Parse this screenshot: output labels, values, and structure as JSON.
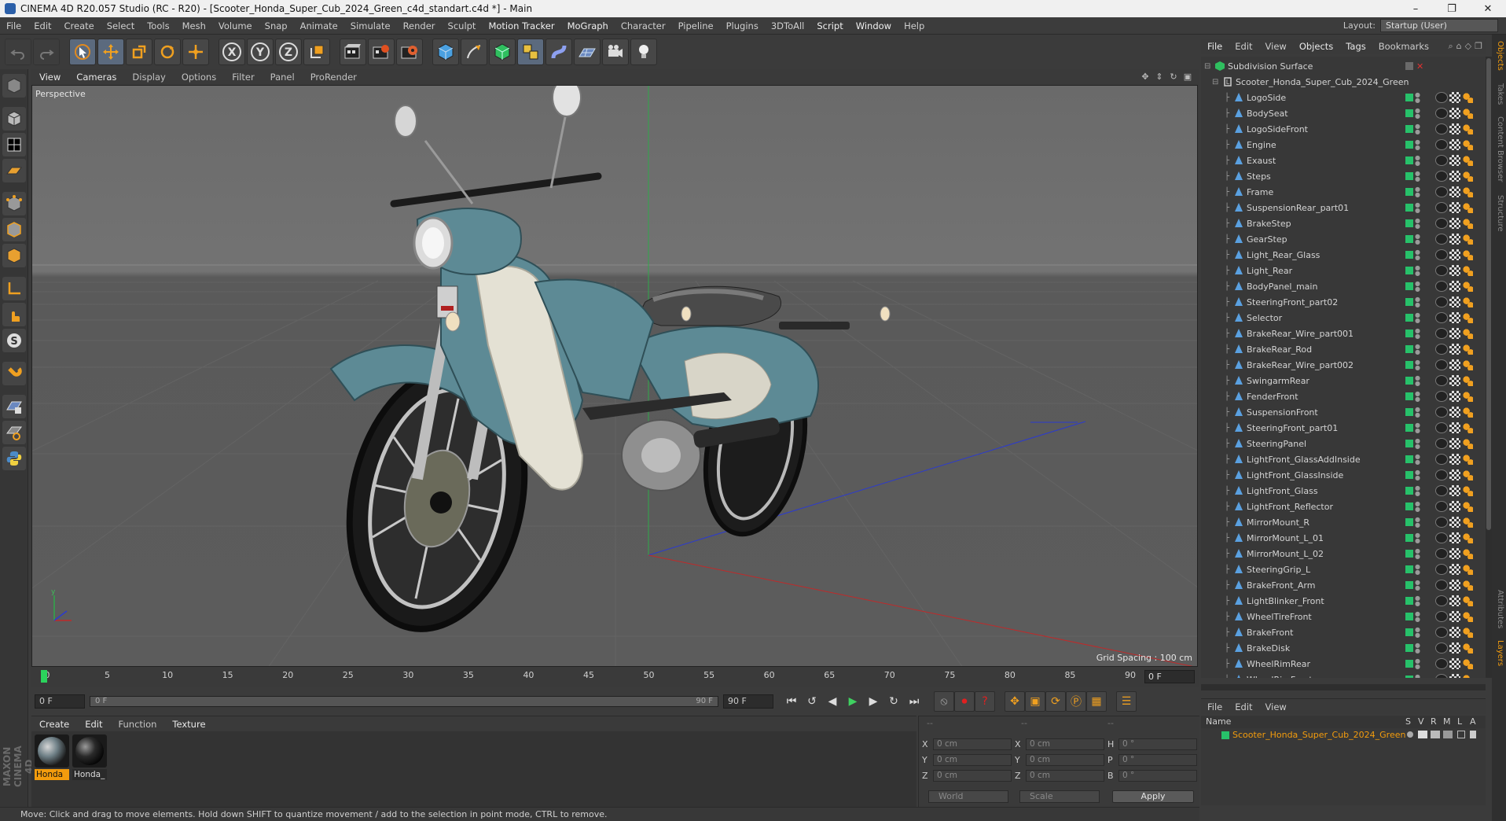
{
  "window": {
    "title": "CINEMA 4D R20.057 Studio (RC - R20) - [Scooter_Honda_Super_Cub_2024_Green_c4d_standart.c4d *] - Main",
    "minimize": "–",
    "maximize": "❐",
    "close": "✕"
  },
  "menubar": {
    "items": [
      "File",
      "Edit",
      "Create",
      "Select",
      "Tools",
      "Mesh",
      "Volume",
      "Snap",
      "Animate",
      "Simulate",
      "Render",
      "Sculpt",
      "Motion Tracker",
      "MoGraph",
      "Character",
      "Pipeline",
      "Plugins",
      "3DToAll",
      "Script",
      "Window",
      "Help"
    ],
    "layout_label": "Layout:",
    "layout_value": "Startup (User)"
  },
  "toolbar": {
    "icons": [
      "undo-icon",
      "redo-icon",
      "live-select-icon",
      "move-icon",
      "scale-icon",
      "rotate-icon",
      "transform-icon",
      "x-axis-icon",
      "y-axis-icon",
      "z-axis-icon",
      "coordinate-system-icon",
      "render-view-icon",
      "render-picture-viewer-icon",
      "edit-render-settings-icon",
      "cube-icon",
      "pen-icon",
      "subdivision-icon",
      "cloner-icon",
      "deformer-icon",
      "floor-icon",
      "camera-icon",
      "light-icon"
    ]
  },
  "viewport": {
    "menus": [
      "View",
      "Cameras",
      "Display",
      "Options",
      "Filter",
      "Panel",
      "ProRender"
    ],
    "view_label": "Perspective",
    "grid_spacing": "Grid Spacing : 100 cm"
  },
  "timeline": {
    "ticks": [
      "0",
      "5",
      "10",
      "15",
      "20",
      "25",
      "30",
      "35",
      "40",
      "45",
      "50",
      "55",
      "60",
      "65",
      "70",
      "75",
      "80",
      "85",
      "90"
    ],
    "current_frame_field": "0 F",
    "max_frame": 90
  },
  "transport": {
    "start_field": "0 F",
    "range_start": "0 F",
    "range_end": "90 F",
    "end_field": "90 F"
  },
  "materials": {
    "menus": [
      "Create",
      "Edit",
      "Function",
      "Texture"
    ],
    "items": [
      {
        "label": "Honda",
        "selected": true
      },
      {
        "label": "Honda_",
        "selected": false
      }
    ]
  },
  "coordinates": {
    "headers": [
      "--",
      "--",
      "--"
    ],
    "rows": [
      {
        "a1": "X",
        "v1": "0 cm",
        "a2": "X",
        "v2": "0 cm",
        "a3": "H",
        "v3": "0 °"
      },
      {
        "a1": "Y",
        "v1": "0 cm",
        "a2": "Y",
        "v2": "0 cm",
        "a3": "P",
        "v3": "0 °"
      },
      {
        "a1": "Z",
        "v1": "0 cm",
        "a2": "Z",
        "v2": "0 cm",
        "a3": "B",
        "v3": "0 °"
      }
    ],
    "space": "World",
    "mode": "Scale",
    "apply": "Apply"
  },
  "statusbar": {
    "text": "Move: Click and drag to move elements. Hold down SHIFT to quantize movement / add to the selection in point mode, CTRL to remove."
  },
  "object_manager": {
    "menus": [
      "File",
      "Edit",
      "View",
      "Objects",
      "Tags",
      "Bookmarks"
    ],
    "root": "Subdivision Surface",
    "group": "Scooter_Honda_Super_Cub_2024_Green",
    "objects": [
      "LogoSide",
      "BodySeat",
      "LogoSideFront",
      "Engine",
      "Exaust",
      "Steps",
      "Frame",
      "SuspensionRear_part01",
      "BrakeStep",
      "GearStep",
      "Light_Rear_Glass",
      "Light_Rear",
      "BodyPanel_main",
      "SteeringFront_part02",
      "Selector",
      "BrakeRear_Wire_part001",
      "BrakeRear_Rod",
      "BrakeRear_Wire_part002",
      "SwingarmRear",
      "FenderFront",
      "SuspensionFront",
      "SteeringFront_part01",
      "SteeringPanel",
      "LightFront_GlassAddInside",
      "LightFront_GlassInside",
      "LightFront_Glass",
      "LightFront_Reflector",
      "MirrorMount_R",
      "MirrorMount_L_01",
      "MirrorMount_L_02",
      "SteeringGrip_L",
      "BrakeFront_Arm",
      "LightBlinker_Front",
      "WheelTireFront",
      "BrakeFront",
      "BrakeDisk",
      "WheelRimRear",
      "WheelRimFront"
    ]
  },
  "layer_manager": {
    "menus": [
      "File",
      "Edit",
      "View"
    ],
    "columns": [
      "Name",
      "S",
      "V",
      "R",
      "M",
      "L",
      "A"
    ],
    "layer_name": "Scooter_Honda_Super_Cub_2024_Green"
  },
  "side_tabs": [
    "Objects",
    "Takes",
    "Content Browser",
    "Structure",
    "Attributes",
    "Layers"
  ],
  "colors": {
    "accent": "#f39c0d",
    "layer_green": "#27c16a",
    "playhead": "#2bd35c"
  }
}
